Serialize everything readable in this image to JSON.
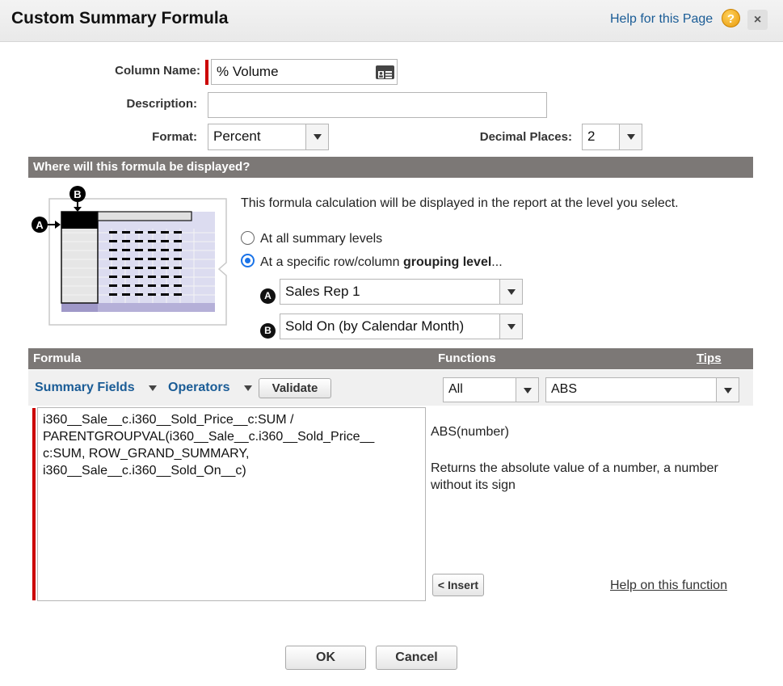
{
  "dialog": {
    "title": "Custom Summary Formula",
    "help_link": "Help for this Page",
    "help_icon": "?",
    "close_icon": "×"
  },
  "fields": {
    "column_name_label": "Column Name:",
    "column_name_value": "% Volume",
    "description_label": "Description:",
    "description_value": "",
    "format_label": "Format:",
    "format_value": "Percent",
    "decimal_label": "Decimal Places:",
    "decimal_value": "2"
  },
  "display_section": {
    "header": "Where will this formula be displayed?",
    "intro": "This formula calculation will be displayed in the report at the level you select.",
    "option_all": "At all summary levels",
    "option_specific_prefix": "At a specific row/column ",
    "option_specific_bold": "grouping level",
    "option_specific_suffix": "...",
    "marker_a": "A",
    "marker_b": "B",
    "grouping_a_value": "Sales Rep 1",
    "grouping_b_value": "Sold On (by Calendar Month)"
  },
  "formula_section": {
    "header_formula": "Formula",
    "header_functions": "Functions",
    "header_tips": "Tips",
    "summary_fields": "Summary Fields",
    "operators": "Operators",
    "validate": "Validate",
    "category_value": "All",
    "function_value": "ABS",
    "formula_text": "i360__Sale__c.i360__Sold_Price__c:SUM /\nPARENTGROUPVAL(i360__Sale__c.i360__Sold_Price__\nc:SUM, ROW_GRAND_SUMMARY,\ni360__Sale__c.i360__Sold_On__c)",
    "function_signature": "ABS(number)",
    "function_description": "Returns the absolute value of a number, a number without its sign",
    "insert": "< Insert",
    "help_function": "Help on this function"
  },
  "footer": {
    "ok": "OK",
    "cancel": "Cancel"
  },
  "colors": {
    "section_bar": "#7c7876",
    "required": "#cc0000",
    "link": "#1a5c96",
    "radio_accent": "#1a73e8"
  },
  "icons": [
    "help-icon",
    "close-icon",
    "contact-card-icon",
    "chevron-down-icon"
  ]
}
